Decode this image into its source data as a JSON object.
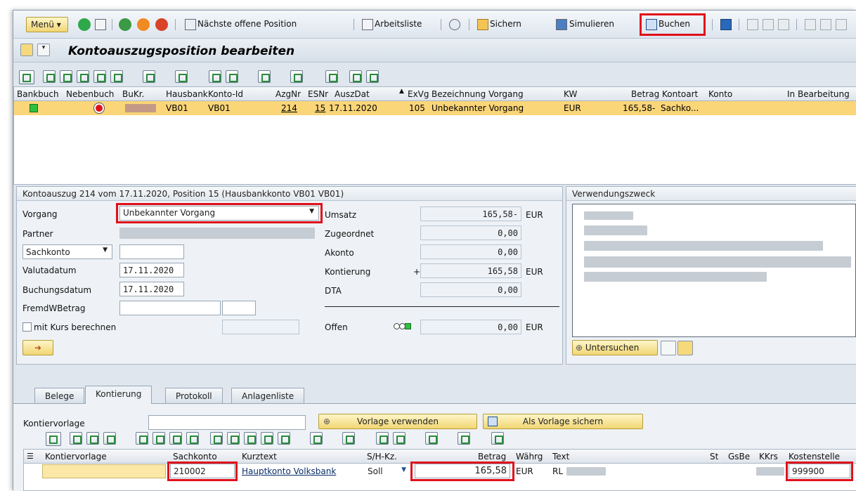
{
  "toolbar": {
    "menu_label": "Menü",
    "next_open_label": "Nächste offene Position",
    "worklist_label": "Arbeitsliste",
    "save_label": "Sichern",
    "simulate_label": "Simulieren",
    "post_label": "Buchen"
  },
  "page_title": "Kontoauszugsposition bearbeiten",
  "top_grid": {
    "columns": [
      "Bankbuch",
      "Nebenbuch",
      "BuKr.",
      "Hausbank",
      "Konto-Id",
      "AzgNr",
      "ESNr",
      "AuszDat",
      "ExVg",
      "Bezeichnung Vorgang",
      "KW",
      "Betrag",
      "Kontoart",
      "Konto",
      "In Bearbeitung"
    ],
    "row": {
      "hausbank": "VB01",
      "konto_id": "VB01",
      "azgnr": "214",
      "esnr": "15",
      "auszdat": "17.11.2020",
      "exvg": "105",
      "bezeichnung": "Unbekannter Vorgang",
      "kw": "EUR",
      "betrag": "165,58-",
      "kontoart": "Sachko..."
    }
  },
  "detail": {
    "header": "Kontoauszug 214 vom 17.11.2020, Position 15 (Hausbankkonto VB01 VB01)",
    "vorgang_label": "Vorgang",
    "vorgang_value": "Unbekannter Vorgang",
    "partner_label": "Partner",
    "konto_type": "Sachkonto",
    "valutadatum_label": "Valutadatum",
    "valutadatum": "17.11.2020",
    "buchungsdatum_label": "Buchungsdatum",
    "buchungsdatum": "17.11.2020",
    "fremdw_label": "FremdWBetrag",
    "kurs_label": "mit Kurs berechnen",
    "umsatz_label": "Umsatz",
    "umsatz": "165,58-",
    "umsatz_cur": "EUR",
    "zugeordnet_label": "Zugeordnet",
    "zugeordnet": "0,00",
    "akonto_label": "Akonto",
    "akonto": "0,00",
    "kontierung_label": "Kontierung",
    "kontierung_sign": "+",
    "kontierung": "165,58",
    "kontierung_cur": "EUR",
    "dta_label": "DTA",
    "dta": "0,00",
    "offen_label": "Offen",
    "offen": "0,00",
    "offen_cur": "EUR"
  },
  "verwendungszweck": {
    "header": "Verwendungszweck",
    "untersuchen_label": "Untersuchen"
  },
  "tabs": [
    "Belege",
    "Kontierung",
    "Protokoll",
    "Anlagenliste"
  ],
  "kontierung": {
    "vorlage_label": "Kontiervorlage",
    "vorlage_verwenden": "Vorlage verwenden",
    "als_vorlage_sichern": "Als Vorlage sichern",
    "columns": [
      "Kontiervorlage",
      "Sachkonto",
      "Kurztext",
      "S/H-Kz.",
      "Betrag",
      "Währg",
      "Text",
      "St",
      "GsBe",
      "KKrs",
      "Kostenstelle"
    ],
    "row": {
      "sachkonto": "210002",
      "kurztext": "Hauptkonto Volksbank",
      "shkz": "Soll",
      "betrag": "165,58",
      "waehrung": "EUR",
      "text": "RL",
      "kostenstelle": "999900"
    }
  },
  "colors": {
    "highlight": "#e0101a",
    "row_selected": "#fbd679",
    "accent_button": "#f1d674"
  }
}
